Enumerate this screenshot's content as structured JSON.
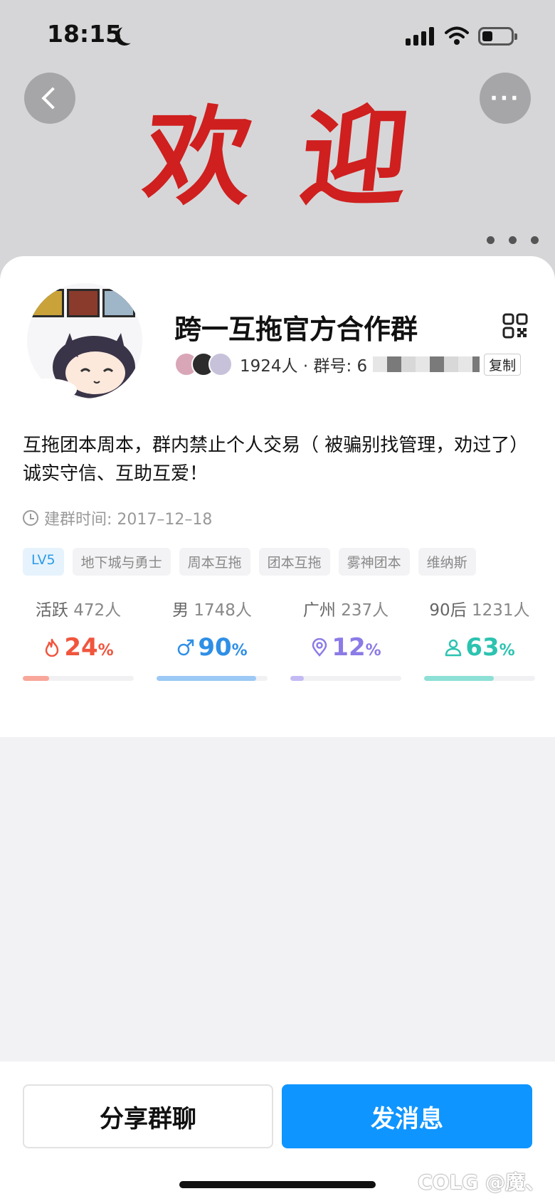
{
  "status_bar": {
    "time": "18:15",
    "icons": [
      "moon-icon",
      "signal-icon",
      "wifi-icon",
      "battery-icon"
    ]
  },
  "banner": {
    "text": "欢迎",
    "text_color": "#cf1f1f",
    "page_indicator_count": 3
  },
  "group": {
    "name": "跨一互拖官方合作群",
    "member_text": "1924人 · 群号: 6",
    "copy_label": "复制",
    "description": "互拖团本周本，群内禁止个人交易（ 被骗别找管理，劝过了）诚实守信、互助互爱！",
    "created_label": "建群时间: 2017–12–18",
    "tags": [
      {
        "label": "LV5",
        "type": "level"
      },
      {
        "label": "地下城与勇士"
      },
      {
        "label": "周本互拖"
      },
      {
        "label": "团本互拖"
      },
      {
        "label": "雾神团本"
      },
      {
        "label": "维纳斯"
      }
    ]
  },
  "stats": [
    {
      "label": "活跃",
      "count": "472人",
      "value": "24",
      "unit": "%",
      "percent": 24,
      "color": "#f0553e",
      "bar_color": "#f8a79a",
      "icon": "flame-icon"
    },
    {
      "label": "男",
      "count": "1748人",
      "value": "90",
      "unit": "%",
      "percent": 90,
      "color": "#2f8fe6",
      "bar_color": "#9cc9f5",
      "icon": "male-icon"
    },
    {
      "label": "广州",
      "count": "237人",
      "value": "12",
      "unit": "%",
      "percent": 12,
      "color": "#8b7be6",
      "bar_color": "#c4baf3",
      "icon": "location-icon"
    },
    {
      "label": "90后",
      "count": "1231人",
      "value": "63",
      "unit": "%",
      "percent": 63,
      "color": "#2cc3b0",
      "bar_color": "#8de0d5",
      "icon": "person-icon"
    }
  ],
  "actions": {
    "share_label": "分享群聊",
    "send_label": "发消息",
    "send_color": "#0f95ff"
  },
  "watermark": "COLG @魔、"
}
